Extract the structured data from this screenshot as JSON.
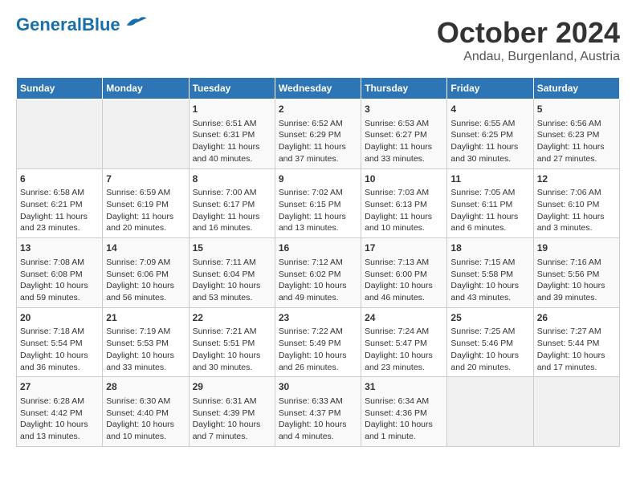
{
  "header": {
    "logo_general": "General",
    "logo_blue": "Blue",
    "month": "October 2024",
    "location": "Andau, Burgenland, Austria"
  },
  "days_of_week": [
    "Sunday",
    "Monday",
    "Tuesday",
    "Wednesday",
    "Thursday",
    "Friday",
    "Saturday"
  ],
  "weeks": [
    [
      {
        "day": "",
        "info": ""
      },
      {
        "day": "",
        "info": ""
      },
      {
        "day": "1",
        "info": "Sunrise: 6:51 AM\nSunset: 6:31 PM\nDaylight: 11 hours and 40 minutes."
      },
      {
        "day": "2",
        "info": "Sunrise: 6:52 AM\nSunset: 6:29 PM\nDaylight: 11 hours and 37 minutes."
      },
      {
        "day": "3",
        "info": "Sunrise: 6:53 AM\nSunset: 6:27 PM\nDaylight: 11 hours and 33 minutes."
      },
      {
        "day": "4",
        "info": "Sunrise: 6:55 AM\nSunset: 6:25 PM\nDaylight: 11 hours and 30 minutes."
      },
      {
        "day": "5",
        "info": "Sunrise: 6:56 AM\nSunset: 6:23 PM\nDaylight: 11 hours and 27 minutes."
      }
    ],
    [
      {
        "day": "6",
        "info": "Sunrise: 6:58 AM\nSunset: 6:21 PM\nDaylight: 11 hours and 23 minutes."
      },
      {
        "day": "7",
        "info": "Sunrise: 6:59 AM\nSunset: 6:19 PM\nDaylight: 11 hours and 20 minutes."
      },
      {
        "day": "8",
        "info": "Sunrise: 7:00 AM\nSunset: 6:17 PM\nDaylight: 11 hours and 16 minutes."
      },
      {
        "day": "9",
        "info": "Sunrise: 7:02 AM\nSunset: 6:15 PM\nDaylight: 11 hours and 13 minutes."
      },
      {
        "day": "10",
        "info": "Sunrise: 7:03 AM\nSunset: 6:13 PM\nDaylight: 11 hours and 10 minutes."
      },
      {
        "day": "11",
        "info": "Sunrise: 7:05 AM\nSunset: 6:11 PM\nDaylight: 11 hours and 6 minutes."
      },
      {
        "day": "12",
        "info": "Sunrise: 7:06 AM\nSunset: 6:10 PM\nDaylight: 11 hours and 3 minutes."
      }
    ],
    [
      {
        "day": "13",
        "info": "Sunrise: 7:08 AM\nSunset: 6:08 PM\nDaylight: 10 hours and 59 minutes."
      },
      {
        "day": "14",
        "info": "Sunrise: 7:09 AM\nSunset: 6:06 PM\nDaylight: 10 hours and 56 minutes."
      },
      {
        "day": "15",
        "info": "Sunrise: 7:11 AM\nSunset: 6:04 PM\nDaylight: 10 hours and 53 minutes."
      },
      {
        "day": "16",
        "info": "Sunrise: 7:12 AM\nSunset: 6:02 PM\nDaylight: 10 hours and 49 minutes."
      },
      {
        "day": "17",
        "info": "Sunrise: 7:13 AM\nSunset: 6:00 PM\nDaylight: 10 hours and 46 minutes."
      },
      {
        "day": "18",
        "info": "Sunrise: 7:15 AM\nSunset: 5:58 PM\nDaylight: 10 hours and 43 minutes."
      },
      {
        "day": "19",
        "info": "Sunrise: 7:16 AM\nSunset: 5:56 PM\nDaylight: 10 hours and 39 minutes."
      }
    ],
    [
      {
        "day": "20",
        "info": "Sunrise: 7:18 AM\nSunset: 5:54 PM\nDaylight: 10 hours and 36 minutes."
      },
      {
        "day": "21",
        "info": "Sunrise: 7:19 AM\nSunset: 5:53 PM\nDaylight: 10 hours and 33 minutes."
      },
      {
        "day": "22",
        "info": "Sunrise: 7:21 AM\nSunset: 5:51 PM\nDaylight: 10 hours and 30 minutes."
      },
      {
        "day": "23",
        "info": "Sunrise: 7:22 AM\nSunset: 5:49 PM\nDaylight: 10 hours and 26 minutes."
      },
      {
        "day": "24",
        "info": "Sunrise: 7:24 AM\nSunset: 5:47 PM\nDaylight: 10 hours and 23 minutes."
      },
      {
        "day": "25",
        "info": "Sunrise: 7:25 AM\nSunset: 5:46 PM\nDaylight: 10 hours and 20 minutes."
      },
      {
        "day": "26",
        "info": "Sunrise: 7:27 AM\nSunset: 5:44 PM\nDaylight: 10 hours and 17 minutes."
      }
    ],
    [
      {
        "day": "27",
        "info": "Sunrise: 6:28 AM\nSunset: 4:42 PM\nDaylight: 10 hours and 13 minutes."
      },
      {
        "day": "28",
        "info": "Sunrise: 6:30 AM\nSunset: 4:40 PM\nDaylight: 10 hours and 10 minutes."
      },
      {
        "day": "29",
        "info": "Sunrise: 6:31 AM\nSunset: 4:39 PM\nDaylight: 10 hours and 7 minutes."
      },
      {
        "day": "30",
        "info": "Sunrise: 6:33 AM\nSunset: 4:37 PM\nDaylight: 10 hours and 4 minutes."
      },
      {
        "day": "31",
        "info": "Sunrise: 6:34 AM\nSunset: 4:36 PM\nDaylight: 10 hours and 1 minute."
      },
      {
        "day": "",
        "info": ""
      },
      {
        "day": "",
        "info": ""
      }
    ]
  ]
}
